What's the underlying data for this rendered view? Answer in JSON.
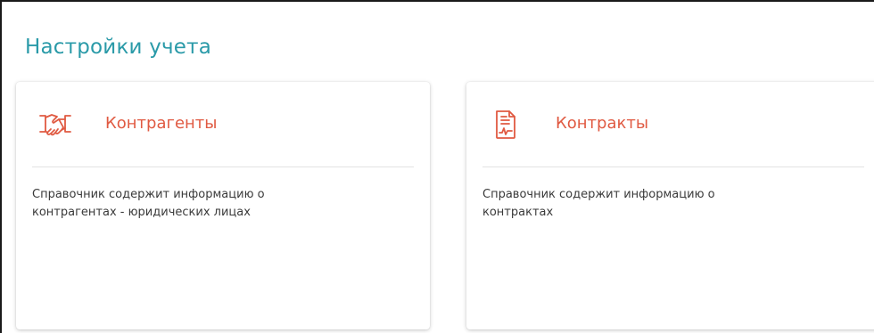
{
  "page": {
    "title": "Настройки учета"
  },
  "cards": [
    {
      "title": "Контрагенты",
      "description": "Справочник содержит информацию о контрагентах - юридических лицах",
      "icon": "handshake-icon"
    },
    {
      "title": "Контракты",
      "description": "Справочник содержит информацию о контрактах",
      "icon": "contract-document-icon"
    }
  ],
  "colors": {
    "title": "#2a9aa8",
    "accent": "#e05a42",
    "text": "#3a3a3a",
    "divider": "#e3e3e3"
  }
}
